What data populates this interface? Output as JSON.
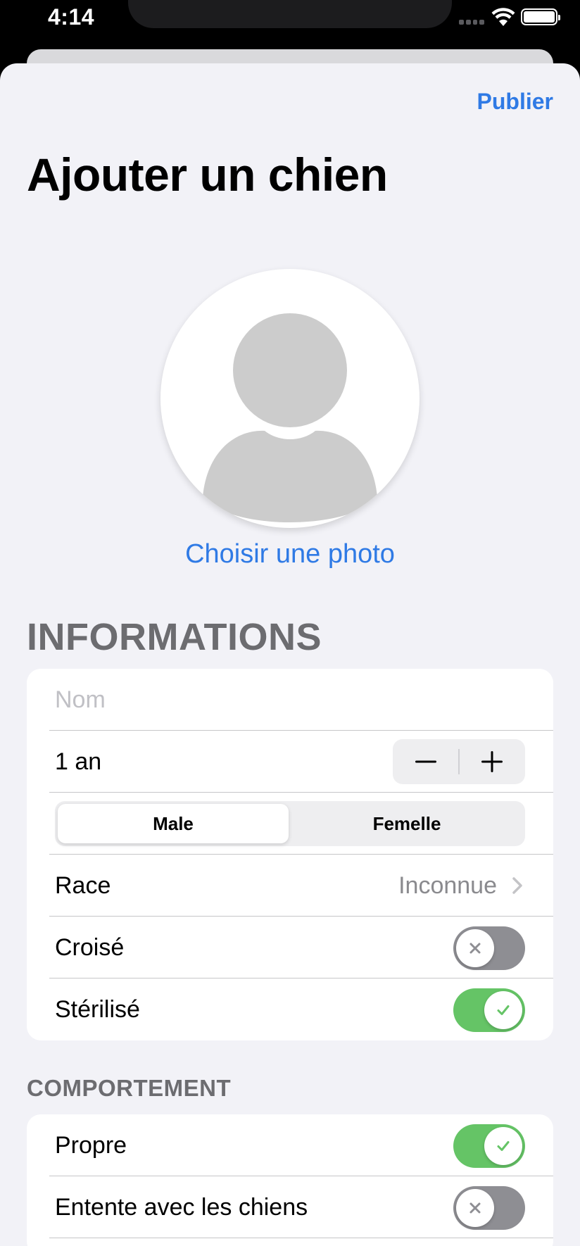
{
  "status_bar": {
    "time": "4:14"
  },
  "header": {
    "publish_label": "Publier",
    "title": "Ajouter un chien"
  },
  "photo": {
    "choose_label": "Choisir une photo"
  },
  "informations": {
    "section_title": "INFORMATIONS",
    "name_placeholder": "Nom",
    "age_value": "1 an",
    "sex_options": [
      "Male",
      "Femelle"
    ],
    "sex_selected": "Male",
    "race_label": "Race",
    "race_value": "Inconnue",
    "crossbreed_label": "Croisé",
    "crossbreed_on": false,
    "sterilized_label": "Stérilisé",
    "sterilized_on": true
  },
  "behavior": {
    "section_title": "COMPORTEMENT",
    "clean_label": "Propre",
    "clean_on": true,
    "dogs_label": "Entente avec les chiens",
    "dogs_on": false
  },
  "colors": {
    "accent": "#2f7ae5",
    "toggle_on": "#65c466",
    "toggle_off": "#8e8e93",
    "background": "#f2f2f7"
  }
}
